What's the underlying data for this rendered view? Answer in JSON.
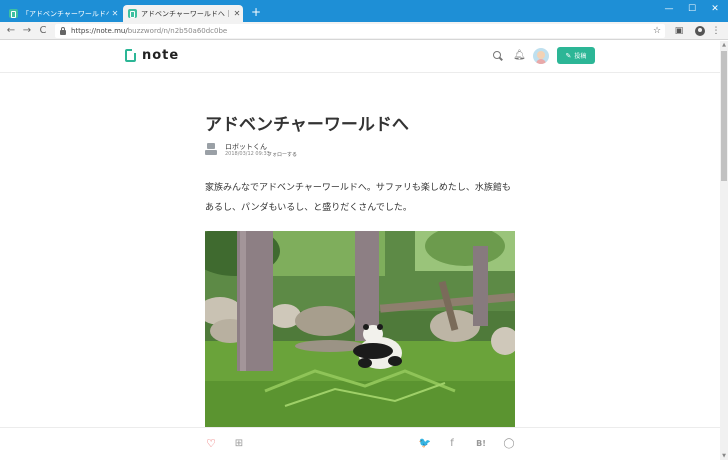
{
  "browser": {
    "tabs": [
      {
        "title": "「アドベンチャーワールドへ」の新着の",
        "active": false
      },
      {
        "title": "アドベンチャーワールドへ｜ロボットくん",
        "active": true
      }
    ],
    "new_tab_glyph": "+",
    "window_controls": {
      "minimize": "—",
      "maximize": "☐",
      "close": "✕"
    },
    "nav": {
      "back": "←",
      "forward": "→",
      "reload": "C"
    },
    "url_host": "https://note.mu/",
    "url_path": "buzzword/n/n2b50a60dc0be",
    "star_glyph": "☆",
    "menu_glyph": "⋮"
  },
  "site": {
    "logo_text": "note",
    "post_button_label": "投稿",
    "accent_color": "#2cb696"
  },
  "article": {
    "title": "アドベンチャーワールドへ",
    "author": "ロボットくん",
    "date": "2018/03/12 09:33",
    "follow_label": "フォローする",
    "body_lines": [
      "家族みんなでアドベンチャーワールドへ。サファリも楽しめたし、水族館も",
      "あるし、パンダもいるし、と盛りだくさんでした。"
    ]
  },
  "actions": {
    "like_glyph": "♡",
    "magazine_glyph": "⊞",
    "twitter_glyph": "🐦",
    "facebook_glyph": "f",
    "hatena_label": "B!",
    "line_glyph": "◯",
    "like_color": "#e64a4a"
  },
  "icons": [
    "search-icon",
    "bell-icon",
    "pencil-icon",
    "heart-icon",
    "magazine-icon",
    "twitter-icon",
    "facebook-icon",
    "hatena-icon",
    "line-icon",
    "lock-icon",
    "star-icon"
  ]
}
